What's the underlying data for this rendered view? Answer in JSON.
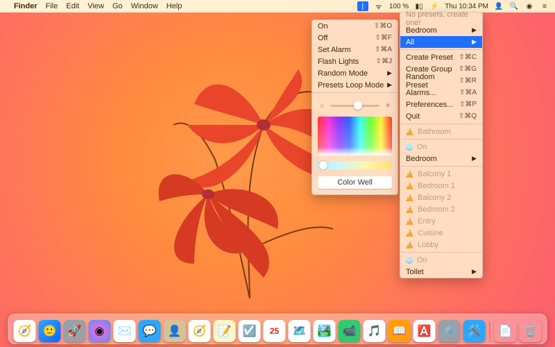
{
  "menubar": {
    "app": "Finder",
    "items": [
      "File",
      "Edit",
      "View",
      "Go",
      "Window",
      "Help"
    ],
    "battery": "100 %",
    "clock": "Thu 10:34 PM"
  },
  "leftPanel": {
    "rows": [
      {
        "label": "On",
        "shortcut": "⇧⌘O"
      },
      {
        "label": "Off",
        "shortcut": "⇧⌘F"
      },
      {
        "label": "Set Alarm",
        "shortcut": "⇧⌘A"
      },
      {
        "label": "Flash Lights",
        "shortcut": "⇧⌘J"
      },
      {
        "label": "Random Mode",
        "arrow": true
      },
      {
        "label": "Presets Loop Mode",
        "arrow": true
      }
    ],
    "slider_value": 0.48,
    "colorWell": "Color Well"
  },
  "rightPanel": {
    "top": [
      {
        "label": "No presets, create one!",
        "dim": true
      }
    ],
    "presets": [
      {
        "label": "Bedroom",
        "arrow": true
      },
      {
        "label": "All",
        "arrow": true,
        "hl": true
      }
    ],
    "commands": [
      {
        "label": "Create Preset",
        "shortcut": "⇧⌘C"
      },
      {
        "label": "Create Group",
        "shortcut": "⇧⌘G"
      },
      {
        "label": "Random Preset",
        "shortcut": "⇧⌘R"
      },
      {
        "label": "Alarms...",
        "shortcut": "⇧⌘A"
      },
      {
        "label": "Preferences...",
        "shortcut": "⇧⌘P"
      },
      {
        "label": "Quit",
        "shortcut": "⇧⌘Q"
      }
    ],
    "rooms1": [
      {
        "label": "Bathroom",
        "warn": true,
        "dim": true
      }
    ],
    "onrow": {
      "label": "On",
      "bulb": true,
      "dim": true
    },
    "bedroom": {
      "label": "Bedroom",
      "arrow": true
    },
    "rooms2": [
      {
        "label": "Balcony 1",
        "warn": true,
        "dim": true
      },
      {
        "label": "Bedroom 1",
        "warn": true,
        "dim": true
      },
      {
        "label": "Balcony 2",
        "warn": true,
        "dim": true
      },
      {
        "label": "Bedroom 2",
        "warn": true,
        "dim": true
      },
      {
        "label": "Entry",
        "warn": true,
        "dim": true
      },
      {
        "label": "Cuisine",
        "warn": true,
        "dim": true
      },
      {
        "label": "Lobby",
        "warn": true,
        "dim": true
      }
    ],
    "onrow2": {
      "label": "On",
      "bulb": true,
      "dim": true
    },
    "toilet": {
      "label": "Toilet",
      "arrow": true
    }
  },
  "dock": [
    {
      "name": "safari",
      "bg": "#ffffff",
      "sym": "🧭"
    },
    {
      "name": "finder",
      "bg": "linear-gradient(135deg,#2aa8ff,#0a66ff)",
      "sym": "🙂"
    },
    {
      "name": "launchpad",
      "bg": "#9aa0a6",
      "sym": "🚀"
    },
    {
      "name": "siri",
      "bg": "radial-gradient(circle,#ff6ad5,#5b8dff)",
      "sym": "◉"
    },
    {
      "name": "mail",
      "bg": "#ffffff",
      "sym": "✉️"
    },
    {
      "name": "messages",
      "bg": "#2aa8ff",
      "sym": "💬"
    },
    {
      "name": "contacts",
      "bg": "#d8c097",
      "sym": "👤"
    },
    {
      "name": "safari2",
      "bg": "#ffffff",
      "sym": "🧭"
    },
    {
      "name": "notes",
      "bg": "#fff6c7",
      "sym": "📝"
    },
    {
      "name": "reminders",
      "bg": "#ffffff",
      "sym": "☑️"
    },
    {
      "name": "calendar",
      "bg": "#ffffff",
      "sym": "25"
    },
    {
      "name": "maps",
      "bg": "#ffffff",
      "sym": "🗺️"
    },
    {
      "name": "photos",
      "bg": "#ffffff",
      "sym": "🏞️"
    },
    {
      "name": "facetime",
      "bg": "#2ecc71",
      "sym": "📹"
    },
    {
      "name": "itunes",
      "bg": "#ffffff",
      "sym": "🎵"
    },
    {
      "name": "ibooks",
      "bg": "#ff9f0a",
      "sym": "📖"
    },
    {
      "name": "appstore",
      "bg": "#ffffff",
      "sym": "🅰️"
    },
    {
      "name": "preferences",
      "bg": "#9aa0a6",
      "sym": "⚙️"
    },
    {
      "name": "xcode",
      "bg": "#2aa8ff",
      "sym": "🛠️"
    }
  ],
  "dockRight": [
    {
      "name": "downloads",
      "bg": "transparent",
      "sym": "📄"
    },
    {
      "name": "trash",
      "bg": "transparent",
      "sym": "🗑️"
    }
  ]
}
